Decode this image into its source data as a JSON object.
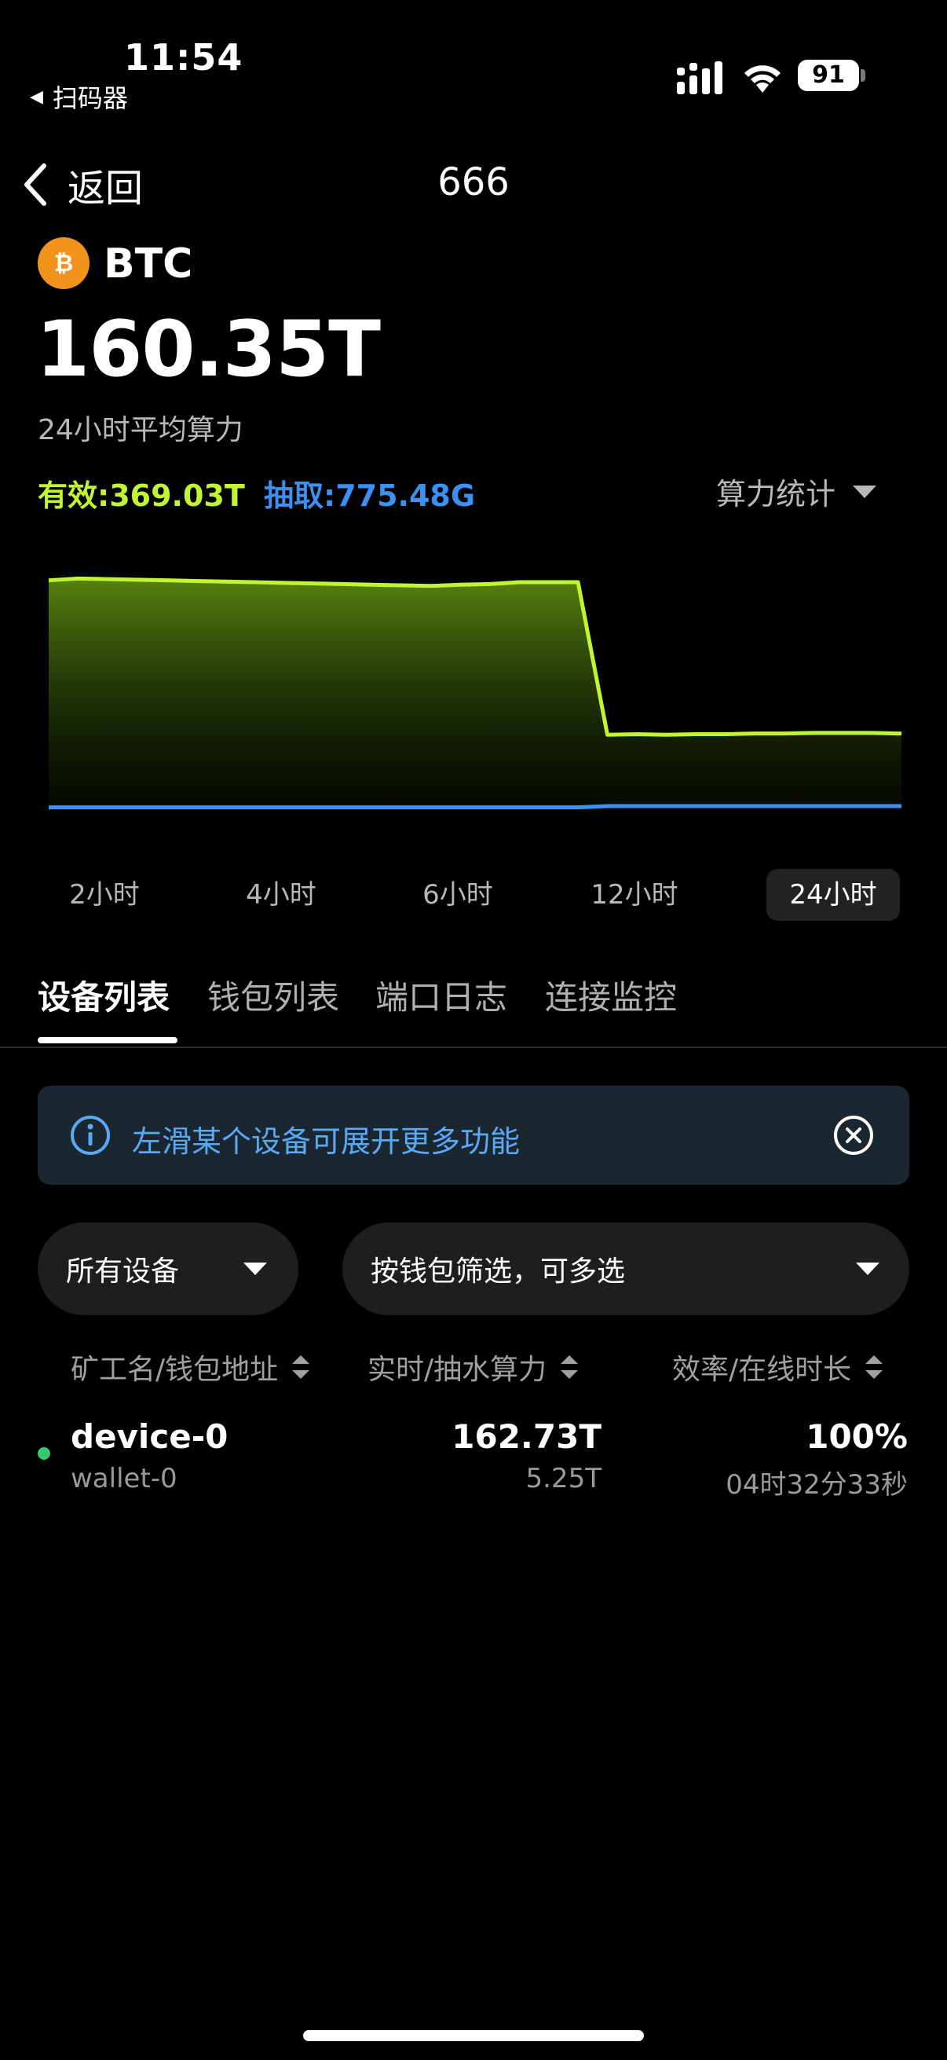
{
  "status_bar": {
    "time": "11:54",
    "back_app": "扫码器",
    "battery": "91"
  },
  "nav": {
    "back_label": "返回",
    "title": "666"
  },
  "coin": {
    "name": "BTC",
    "icon": "bitcoin-icon"
  },
  "summary": {
    "hashrate": "160.35T",
    "hashrate_label": "24小时平均算力",
    "valid": "有效:369.03T",
    "extract": "抽取:775.48G",
    "stats_dropdown": "算力统计"
  },
  "colors": {
    "valid": "#c2f531",
    "extract": "#3d8ff2",
    "coin": "#f2931b",
    "online": "#2ecc71"
  },
  "chart_data": {
    "type": "area",
    "series": [
      {
        "color": "#c2f531",
        "values": [
          369,
          372,
          371,
          370,
          369,
          368,
          367,
          366,
          365,
          364,
          363,
          362,
          361,
          360,
          362,
          363,
          366,
          366,
          366,
          120,
          121,
          120,
          121,
          121,
          122,
          122,
          123,
          123,
          123,
          122
        ]
      },
      {
        "color": "#3d8ff2",
        "values": [
          3,
          3,
          3,
          3,
          3,
          3,
          3,
          3,
          3,
          3,
          3,
          3,
          3,
          3,
          3,
          3,
          3,
          3,
          3,
          5,
          5,
          5,
          5,
          5,
          5,
          5,
          5,
          5,
          5,
          5
        ]
      }
    ],
    "ylim": [
      0,
      380
    ]
  },
  "ranges": [
    "2小时",
    "4小时",
    "6小时",
    "12小时",
    "24小时"
  ],
  "active_range": "24小时",
  "tabs": [
    "设备列表",
    "钱包列表",
    "端口日志",
    "连接监控"
  ],
  "banner": {
    "text": "左滑某个设备可展开更多功能"
  },
  "filters": {
    "device": "所有设备",
    "wallet": "按钱包筛选，可多选"
  },
  "table": {
    "headers": [
      "矿工名/钱包地址",
      "实时/抽水算力",
      "效率/在线时长"
    ],
    "rows": [
      {
        "name": "device-0",
        "wallet": "wallet-0",
        "realtime": "162.73T",
        "pump": "5.25T",
        "efficiency": "100%",
        "online": "04时32分33秒"
      }
    ]
  }
}
